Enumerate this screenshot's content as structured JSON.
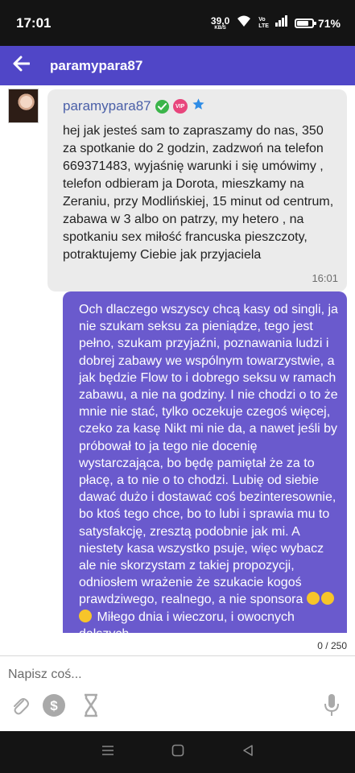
{
  "status_bar": {
    "time": "17:01",
    "net_speed": "39,0",
    "net_speed_unit": "KB/S",
    "volte_top": "Vo",
    "volte_bottom": "LTE",
    "battery_percent": "71%",
    "battery_level": 0.71,
    "icons": [
      "wifi-icon",
      "signal-icon",
      "battery-icon"
    ]
  },
  "header": {
    "title": "paramypara87",
    "back_icon": "arrow-left-icon",
    "color": "#5046c7"
  },
  "incoming_message": {
    "sender": "paramypara87",
    "badges": [
      "verified-check-icon",
      "vip-badge-icon",
      "star-icon"
    ],
    "vip_label": "VIP",
    "text": "hej jak jesteś sam to zapraszamy do nas, 350 za spotkanie do 2 godzin, zadzwoń na telefon 669371483, wyjaśnię warunki i się umówimy , telefon odbieram ja Dorota, mieszkamy na Zeraniu, przy Modlińskiej, 15 minut od centrum, zabawa w 3 albo on patrzy, my hetero , na spotkaniu sex miłość francuska pieszczoty, potraktujemy Ciebie jak przyjaciela",
    "time": "16:01",
    "bubble_color": "#ebebeb"
  },
  "outgoing_message": {
    "text": "Och dlaczego wszyscy chcą kasy od singli, ja nie szukam seksu za pieniądze, tego jest pełno, szukam przyjaźni, poznawania ludzi i dobrej zabawy we wspólnym towarzystwie, a jak będzie Flow to i dobrego seksu w ramach zabawu, a nie na godziny. I nie chodzi o to że mnie nie stać, tylko oczekuje czegoś więcej, czeko za kasę Nikt mi nie da, a nawet jeśli by próbował to ja tego nie docenię wystarczająca, bo będę pamiętał że za to płacę, a to nie o to chodzi. Lubię od siebie dawać dużo i dostawać coś bezinteresownie, bo ktoś tego chce, bo to lubi i sprawia mu to satysfakcję, zresztą podobnie jak mi. A niestety kasa wszystko psuje, więc wybacz ale nie skorzystam z takiej propozycji, odniosłem wrażenie że szukacie kogoś prawdziwego, realnego, a nie sponsora",
    "emojis": [
      "slightly-frowning-face-icon",
      "hushed-face-icon",
      "sad-face-icon"
    ],
    "text_after_emojis": "Miłego dnia i wieczoru, i owocnych dalszych",
    "bubble_color": "#6a5acd"
  },
  "composer": {
    "char_counter": "0 / 250",
    "placeholder": "Napisz coś...",
    "tools": [
      "paperclip-icon",
      "dollar-coin-icon",
      "hourglass-icon",
      "microphone-icon"
    ]
  },
  "nav_bar": {
    "buttons": [
      "recent-apps-icon",
      "home-icon",
      "back-triangle-icon"
    ]
  }
}
